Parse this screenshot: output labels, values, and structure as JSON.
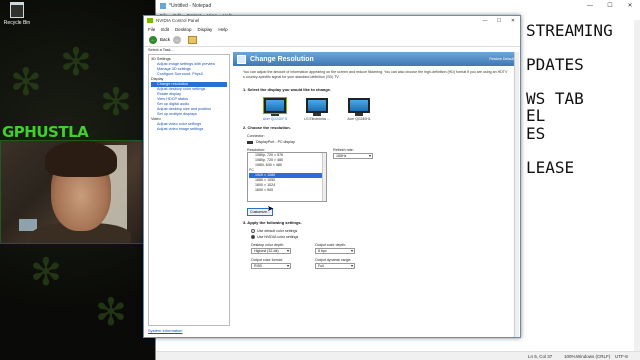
{
  "desktop": {
    "recycle_bin_label": "Recycle Bin"
  },
  "stream": {
    "overlay_name": "GPHUSTLA"
  },
  "notepad": {
    "title": "*Untitled - Notepad",
    "menu": [
      "File",
      "Edit",
      "Format",
      "View",
      "Help"
    ],
    "lines": [
      "STREAMING",
      "",
      "PDATES",
      "",
      "WS TAB",
      "EL",
      "ES",
      "",
      "LEASE"
    ],
    "status": {
      "position": "Ln 5, Col 37",
      "zoom": "100%",
      "line_ending": "Windows (CRLF)",
      "encoding": "UTF-8"
    }
  },
  "nvidia": {
    "window_title": "NVIDIA Control Panel",
    "menu": [
      "File",
      "Edit",
      "Desktop",
      "Display",
      "Help"
    ],
    "toolbar": {
      "back_label": "Back"
    },
    "task_label": "Select a Task...",
    "tree": [
      {
        "label": "3D Settings",
        "type": "cat"
      },
      {
        "label": "Adjust image settings with preview",
        "type": "item"
      },
      {
        "label": "Manage 3D settings",
        "type": "item"
      },
      {
        "label": "Configure Surround, PhysX",
        "type": "item"
      },
      {
        "label": "Display",
        "type": "cat"
      },
      {
        "label": "Change resolution",
        "type": "item",
        "selected": true
      },
      {
        "label": "Adjust desktop color settings",
        "type": "item"
      },
      {
        "label": "Rotate display",
        "type": "item"
      },
      {
        "label": "View HDCP status",
        "type": "item"
      },
      {
        "label": "Set up digital audio",
        "type": "item"
      },
      {
        "label": "Adjust desktop size and position",
        "type": "item"
      },
      {
        "label": "Set up multiple displays",
        "type": "item"
      },
      {
        "label": "Video",
        "type": "cat"
      },
      {
        "label": "Adjust video color settings",
        "type": "item"
      },
      {
        "label": "Adjust video image settings",
        "type": "item"
      }
    ],
    "system_info_link": "System Information",
    "page": {
      "title": "Change Resolution",
      "restore_defaults": "Restore Defaults",
      "description": "You can adjust the amount of information appearing on the screen and reduce flickering. You can also choose the high-definition (HD) format if you are using an HDTV s country-specific signal for your standard-definition (SD) TV.",
      "step1": "1. Select the display you would like to change.",
      "monitors": [
        {
          "name": "Acer QG240Y S",
          "selected": true
        },
        {
          "name": "LG Electronics ...",
          "selected": false
        },
        {
          "name": "Acer QG240HL",
          "selected": false
        }
      ],
      "step2": "2. Choose the resolution.",
      "connector_label": "Connector:",
      "connector_value": "DisplayPort - PC display",
      "resolution_label": "Resolution:",
      "resolutions": [
        {
          "label": "1080p, 720 × 576",
          "type": "item"
        },
        {
          "label": "1080p, 720 × 480",
          "type": "item"
        },
        {
          "label": "1080i, 640 × 480",
          "type": "item"
        },
        {
          "label": "PC",
          "type": "group"
        },
        {
          "label": "1920 × 1080",
          "type": "item",
          "selected": true
        },
        {
          "label": "1680 × 1050",
          "type": "item"
        },
        {
          "label": "1600 × 1024",
          "type": "item"
        },
        {
          "label": "1600 × 900",
          "type": "item"
        }
      ],
      "refresh_label": "Refresh rate:",
      "refresh_value": "165Hz",
      "customize_button": "Customize...",
      "step3": "3. Apply the following settings.",
      "use_default_color": "Use default color settings",
      "use_nvidia_color": "Use NVIDIA color settings",
      "desktop_color_depth_label": "Desktop color depth:",
      "desktop_color_depth_value": "Highest (32-bit)",
      "output_color_depth_label": "Output color depth:",
      "output_color_depth_value": "8 bpc",
      "output_color_format_label": "Output color format:",
      "output_color_format_value": "RGB",
      "output_dynamic_range_label": "Output dynamic range:",
      "output_dynamic_range_value": "Full"
    }
  }
}
